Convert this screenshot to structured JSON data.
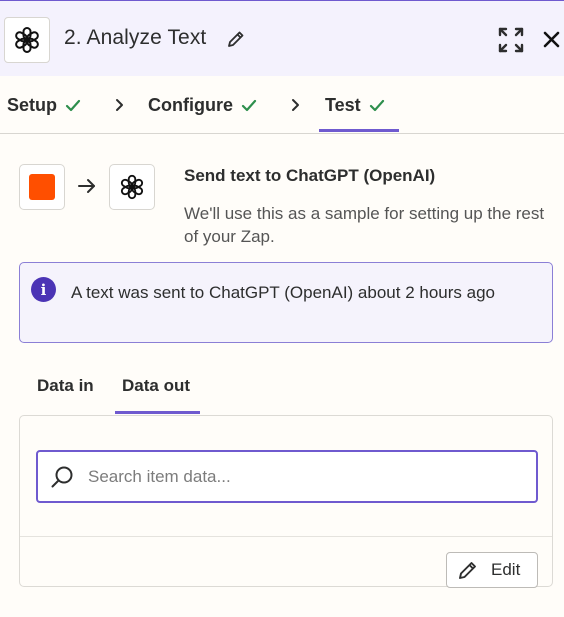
{
  "header": {
    "title": "2. Analyze Text",
    "app_icon": "openai-logo-icon",
    "pencil_icon": "pencil-icon",
    "expand_icon": "expand-icon",
    "close_icon": "close-icon"
  },
  "steps": [
    {
      "label": "Setup",
      "status": "complete"
    },
    {
      "label": "Configure",
      "status": "complete"
    },
    {
      "label": "Test",
      "status": "complete",
      "active": true
    }
  ],
  "colors": {
    "accent": "#6f5acf",
    "check": "#2e8f4d",
    "trigger_app": "#ff4f00",
    "info": "#4b34b5"
  },
  "send": {
    "title": "Send text to ChatGPT (OpenAI)",
    "description": "We'll use this as a sample for setting up the rest of your Zap."
  },
  "info": {
    "text": "A text was sent to ChatGPT (OpenAI) about 2 hours ago"
  },
  "tabs": [
    {
      "label": "Data in",
      "active": false
    },
    {
      "label": "Data out",
      "active": true
    }
  ],
  "search": {
    "placeholder": "Search item data...",
    "value": ""
  },
  "edit_button": {
    "label": "Edit"
  }
}
